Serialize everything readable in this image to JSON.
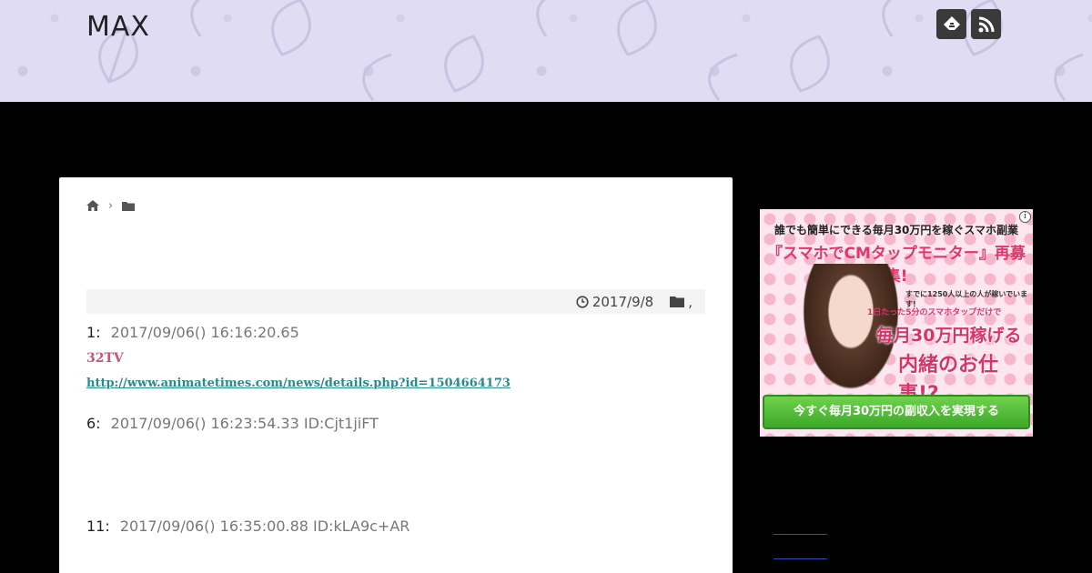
{
  "header": {
    "site_title": "MAX",
    "icons": [
      "feedly-icon",
      "rss-icon"
    ],
    "background_color": "#e0dcf3"
  },
  "article": {
    "breadcrumb": {
      "home_icon": "home-icon",
      "separator": "›",
      "folder_icon": "folder-icon"
    },
    "meta": {
      "date": "2017/9/8",
      "category_separator": ","
    },
    "posts": [
      {
        "num": "1:",
        "info": "2017/09/06() 16:16:20.65"
      },
      {
        "num": "6:",
        "info": "2017/09/06() 16:23:54.33 ID:Cjt1jiFT"
      },
      {
        "num": "11:",
        "info": "2017/09/06() 16:35:00.88 ID:kLA9c+AR"
      }
    ],
    "name_text": "32TV",
    "link_text": "http://www.animatetimes.com/news/details.php?id=1504664173"
  },
  "ad": {
    "info": "i",
    "top": "誰でも簡単にできる毎月30万円を稼ぐスマホ副業",
    "title": "『スマホでCMタップモニター』再募集!",
    "small": "すでに1250人以上の人が稼いでいます!",
    "mid": "1日たった5分のスマホタップだけで",
    "big1": "毎月30万円稼げる",
    "big2": "内緒のお仕事!?",
    "button": "今すぐ毎月30万円の副収入を実現する"
  },
  "colors": {
    "page_bg": "#000000",
    "name_color": "#c0567a",
    "link_color": "#2a8a8a",
    "ad_accent": "#e2356a"
  }
}
